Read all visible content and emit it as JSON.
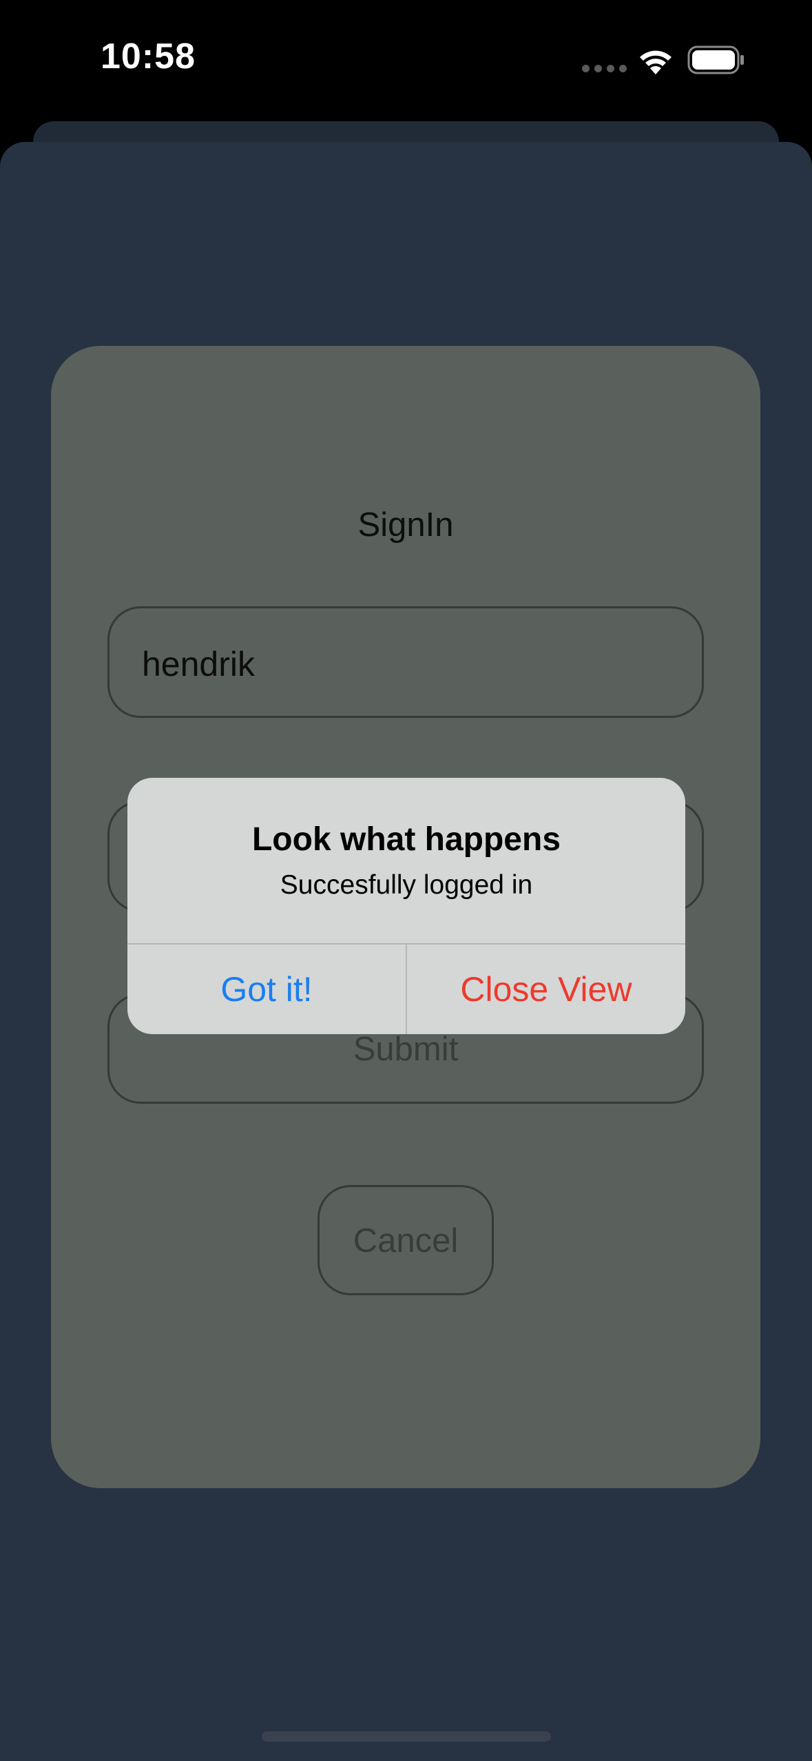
{
  "status_bar": {
    "time": "10:58",
    "icons": [
      "signal-dots-icon",
      "wifi-icon",
      "battery-icon"
    ]
  },
  "signin": {
    "title": "SignIn",
    "username_value": "hendrik",
    "submit_label": "Submit",
    "cancel_label": "Cancel"
  },
  "alert": {
    "title": "Look what happens",
    "message": "Succesfully logged in",
    "buttons": {
      "ok_label": "Got it!",
      "close_label": "Close View"
    }
  },
  "colors": {
    "background": "#000000",
    "sheet": "#273242",
    "card": "#5a605b",
    "alert_bg": "#d5d7d6",
    "primary_action": "#1a7ef0",
    "destructive_action": "#ec3a2d"
  }
}
